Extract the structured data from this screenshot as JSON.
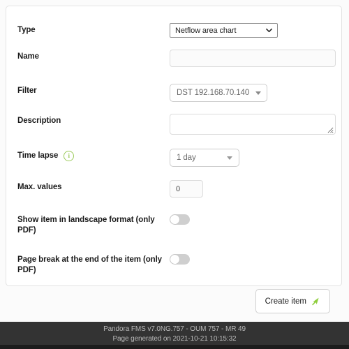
{
  "form": {
    "fields": [
      {
        "key": "type",
        "label": "Type",
        "control": "select-native",
        "value": "Netflow area chart",
        "icon": "chevron-down-icon"
      },
      {
        "key": "name",
        "label": "Name",
        "control": "text",
        "value": "",
        "placeholder": ""
      },
      {
        "key": "filter",
        "label": "Filter",
        "control": "select-pill",
        "value": "DST 192.168.70.140",
        "icon": "caret-down-icon"
      },
      {
        "key": "description",
        "label": "Description",
        "control": "textarea",
        "value": "",
        "placeholder": "",
        "icon": "resize-grip-icon"
      },
      {
        "key": "time_lapse",
        "label": "Time lapse",
        "control": "select-pill",
        "value": "1 day",
        "icon": "info-icon",
        "info_glyph": "i"
      },
      {
        "key": "max_values",
        "label": "Max. values",
        "control": "text-small",
        "value": "0",
        "placeholder": ""
      },
      {
        "key": "landscape",
        "label": "Show item in landscape format (only PDF)",
        "control": "toggle",
        "value": "off"
      },
      {
        "key": "page_break",
        "label": "Page break at the end of the item (only PDF)",
        "control": "toggle",
        "value": "off"
      }
    ]
  },
  "actions": {
    "create_label": "Create item",
    "create_icon": "green-arrow-icon"
  },
  "footer": {
    "version_line": "Pandora FMS v7.0NG.757 - OUM 757 - MR 49",
    "generated_line": "Page generated on 2021-10-21 10:15:32"
  },
  "colors": {
    "accent_green": "#8ece3c",
    "info_green": "#9bca5a",
    "footer_bg": "#333333",
    "footer_text": "#b9b9b9",
    "card_bg": "#ffffff",
    "page_bg": "#fbfbfb"
  }
}
